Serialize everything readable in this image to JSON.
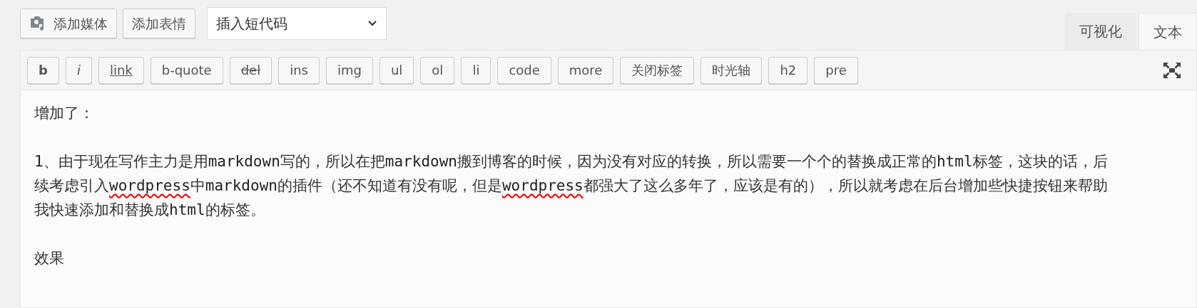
{
  "media_buttons": [
    {
      "label": "添加媒体",
      "kind": "media"
    },
    {
      "label": "添加表情",
      "kind": "plain"
    }
  ],
  "shortcode_select": {
    "value": "插入短代码"
  },
  "mode_tabs": [
    {
      "label": "可视化",
      "selected": false
    },
    {
      "label": "文本",
      "selected": true
    }
  ],
  "quicktags": [
    {
      "label": "b",
      "kind": "bold"
    },
    {
      "label": "i",
      "kind": "italic"
    },
    {
      "label": "link",
      "kind": "underline"
    },
    {
      "label": "b-quote",
      "kind": "plain"
    },
    {
      "label": "del",
      "kind": "strike"
    },
    {
      "label": "ins",
      "kind": "plain"
    },
    {
      "label": "img",
      "kind": "plain"
    },
    {
      "label": "ul",
      "kind": "plain"
    },
    {
      "label": "ol",
      "kind": "plain"
    },
    {
      "label": "li",
      "kind": "plain"
    },
    {
      "label": "code",
      "kind": "plain"
    },
    {
      "label": "more",
      "kind": "plain"
    },
    {
      "label": "关闭标签",
      "kind": "plain"
    },
    {
      "label": "时光轴",
      "kind": "plain"
    },
    {
      "label": "h2",
      "kind": "plain"
    },
    {
      "label": "pre",
      "kind": "plain"
    }
  ],
  "content": [
    {
      "lines": [
        [
          {
            "text": "增加了：",
            "kind": "text"
          }
        ]
      ]
    },
    {
      "lines": [
        [
          {
            "text": "1",
            "kind": "code"
          },
          {
            "text": "、由于现在写作主力是用",
            "kind": "text"
          },
          {
            "text": "markdown",
            "kind": "code"
          },
          {
            "text": "写的，所以在把",
            "kind": "text"
          },
          {
            "text": "markdown",
            "kind": "code"
          },
          {
            "text": "搬到博客的时候，因为没有对应的转换，所以需要一个个的替换成正常的",
            "kind": "text"
          },
          {
            "text": "html",
            "kind": "code"
          },
          {
            "text": "标签，这块的话，后",
            "kind": "text"
          }
        ],
        [
          {
            "text": "续考虑引入",
            "kind": "text"
          },
          {
            "text": "wordpress",
            "kind": "misspelled"
          },
          {
            "text": "中",
            "kind": "text"
          },
          {
            "text": "markdown",
            "kind": "code"
          },
          {
            "text": "的插件（还不知道有没有呢，但是",
            "kind": "text"
          },
          {
            "text": "wordpress",
            "kind": "misspelled"
          },
          {
            "text": "都强大了这么多年了，应该是有的），所以就考虑在后台增加些快捷按钮来帮助",
            "kind": "text"
          }
        ],
        [
          {
            "text": "我快速添加和替换成",
            "kind": "text"
          },
          {
            "text": "html",
            "kind": "code"
          },
          {
            "text": "的标签。",
            "kind": "text"
          }
        ]
      ]
    },
    {
      "lines": [
        [
          {
            "text": "效果",
            "kind": "text"
          }
        ]
      ]
    }
  ]
}
